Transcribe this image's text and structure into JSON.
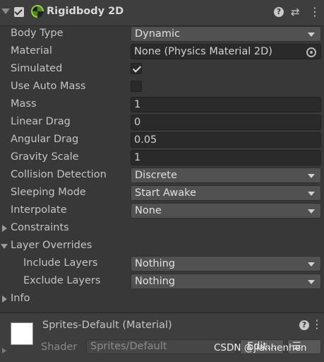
{
  "component": {
    "title": "Rigidbody 2D",
    "enabled": true,
    "icon": "rigidbody2d-icon",
    "help_glyph": "?",
    "preset_glyph": "⇄",
    "menu_glyph": "⋮"
  },
  "properties": {
    "body_type": {
      "label": "Body Type",
      "value": "Dynamic"
    },
    "material": {
      "label": "Material",
      "value": "None (Physics Material 2D)"
    },
    "simulated": {
      "label": "Simulated",
      "checked": true
    },
    "use_auto_mass": {
      "label": "Use Auto Mass",
      "checked": false
    },
    "mass": {
      "label": "Mass",
      "value": "1"
    },
    "linear_drag": {
      "label": "Linear Drag",
      "value": "0"
    },
    "angular_drag": {
      "label": "Angular Drag",
      "value": "0.05"
    },
    "gravity_scale": {
      "label": "Gravity Scale",
      "value": "1"
    },
    "collision_detection": {
      "label": "Collision Detection",
      "value": "Discrete"
    },
    "sleeping_mode": {
      "label": "Sleeping Mode",
      "value": "Start Awake"
    },
    "interpolate": {
      "label": "Interpolate",
      "value": "None"
    }
  },
  "foldouts": {
    "constraints": {
      "label": "Constraints",
      "expanded": false
    },
    "layer_overrides": {
      "label": "Layer Overrides",
      "expanded": true,
      "include_layers": {
        "label": "Include Layers",
        "value": "Nothing"
      },
      "exclude_layers": {
        "label": "Exclude Layers",
        "value": "Nothing"
      }
    },
    "info": {
      "label": "Info",
      "expanded": false
    }
  },
  "material_preview": {
    "title": "Sprites-Default (Material)",
    "shader_label": "Shader",
    "shader_value": "Sprites/Default",
    "edit_label": "Edit...",
    "list_glyph": "☰",
    "help_glyph": "?",
    "menu_glyph": "⋮"
  },
  "watermark": "CSDN @jianhenhen",
  "colors": {
    "background": "#383838",
    "header": "#3e3e3e",
    "field": "#2a2a2a",
    "dropdown": "#515151",
    "text": "#c4c4c4"
  }
}
